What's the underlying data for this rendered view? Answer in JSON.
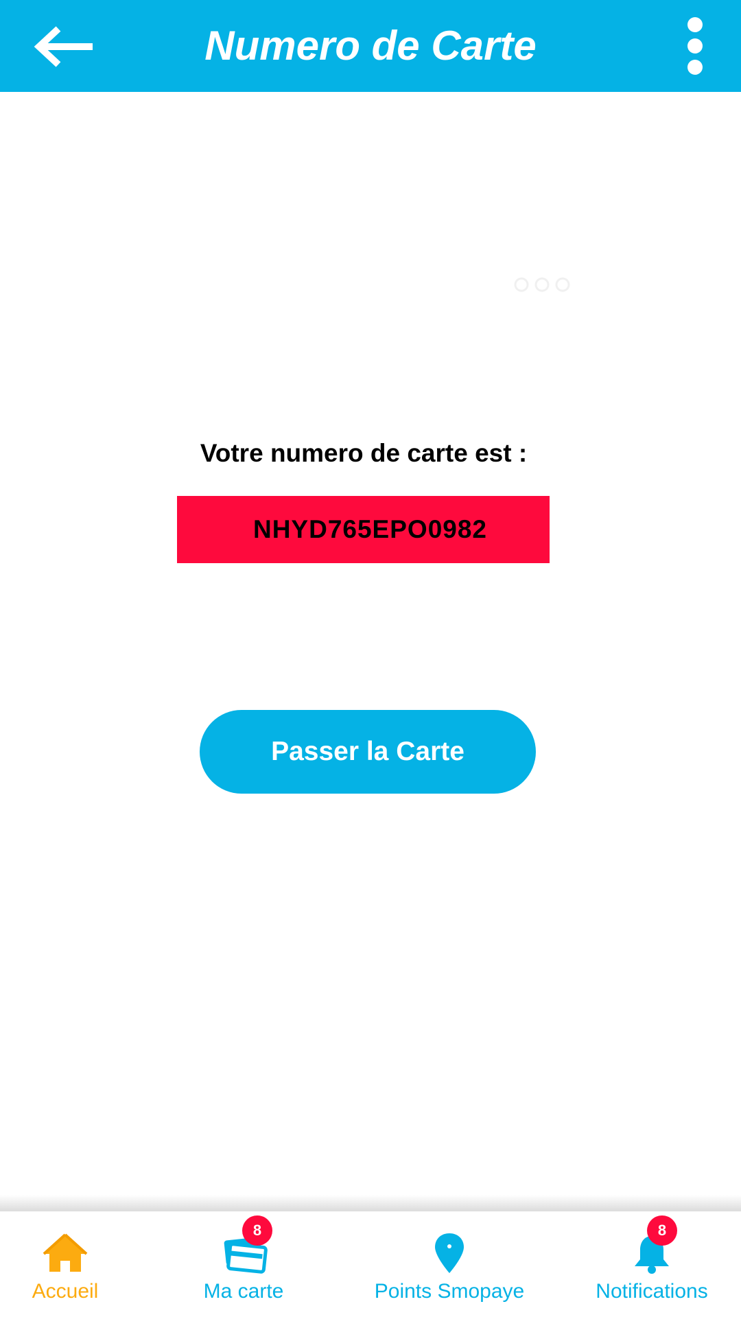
{
  "header": {
    "title": "Numero de Carte",
    "back_icon": "arrow-left-icon",
    "menu_icon": "more-vertical-icon"
  },
  "main": {
    "card_label": "Votre numero de carte est :",
    "card_number": "NHYD765EPO0982",
    "pass_button_label": "Passer la Carte"
  },
  "nav": {
    "items": [
      {
        "label": "Accueil",
        "icon": "home-icon",
        "active": true,
        "badge": ""
      },
      {
        "label": "Ma carte",
        "icon": "card-icon",
        "active": false,
        "badge": "8"
      },
      {
        "label": "Points Smopaye",
        "icon": "location-pin-icon",
        "active": false,
        "badge": ""
      },
      {
        "label": "Notifications",
        "icon": "bell-icon",
        "active": false,
        "badge": "8"
      }
    ]
  },
  "colors": {
    "primary": "#05b2e5",
    "accent_active": "#fcab10",
    "highlight": "#fe0a3d",
    "text": "#000000"
  }
}
